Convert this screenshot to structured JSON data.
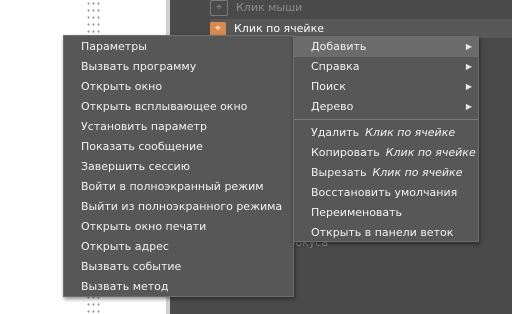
{
  "tree": {
    "rows": [
      {
        "label": "Клик мыши",
        "icon": "event-icon"
      },
      {
        "label": "Клик по ячейке",
        "icon": "event-icon"
      }
    ],
    "partial_label": "фокуса"
  },
  "action_menu": {
    "items": [
      "Параметры",
      "Вызвать программу",
      "Открыть окно",
      "Открыть всплывающее окно",
      "Установить параметр",
      "Показать сообщение",
      "Завершить сессию",
      "Войти в полноэкранный режим",
      "Выйти из полноэкранного режима",
      "Открыть окно печати",
      "Открыть адрес",
      "Вызвать событие",
      "Вызвать метод"
    ]
  },
  "context_menu": {
    "add": "Добавить",
    "help": "Справка",
    "search": "Поиск",
    "tree": "Дерево",
    "delete": "Удалить",
    "copy": "Копировать",
    "cut": "Вырезать",
    "object": "Клик по ячейке",
    "restore_defaults": "Восстановить умолчания",
    "rename": "Переименовать",
    "open_in_tree_panel": "Открыть в панели веток"
  },
  "colors": {
    "panel_bg": "#4a4a4a",
    "menu_bg": "#575757",
    "highlight": "#6b6b6b",
    "event_icon": "#d98a4e"
  }
}
